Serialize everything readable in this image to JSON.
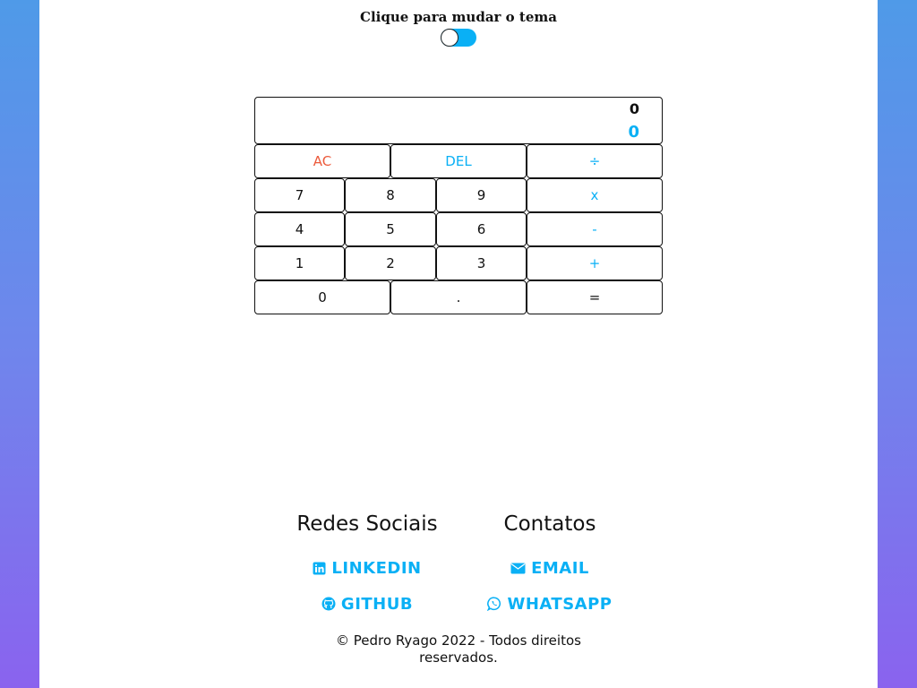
{
  "theme": {
    "label": "Clique para mudar o tema",
    "accent": "#0ab0f5"
  },
  "calculator": {
    "display": {
      "previous": "0",
      "current": "0"
    },
    "rows": [
      [
        "AC",
        "DEL",
        "÷"
      ],
      [
        "7",
        "8",
        "9",
        "x"
      ],
      [
        "4",
        "5",
        "6",
        "-"
      ],
      [
        "1",
        "2",
        "3",
        "+"
      ],
      [
        "0",
        ".",
        "="
      ]
    ]
  },
  "footer": {
    "social_title": "Redes Sociais",
    "contacts_title": "Contatos",
    "linkedin": "LINKEDIN",
    "github": "GITHUB",
    "email": "EMAIL",
    "whatsapp": "WHATSAPP",
    "copyright": "© Pedro Ryago 2022 - Todos direitos reservados."
  }
}
